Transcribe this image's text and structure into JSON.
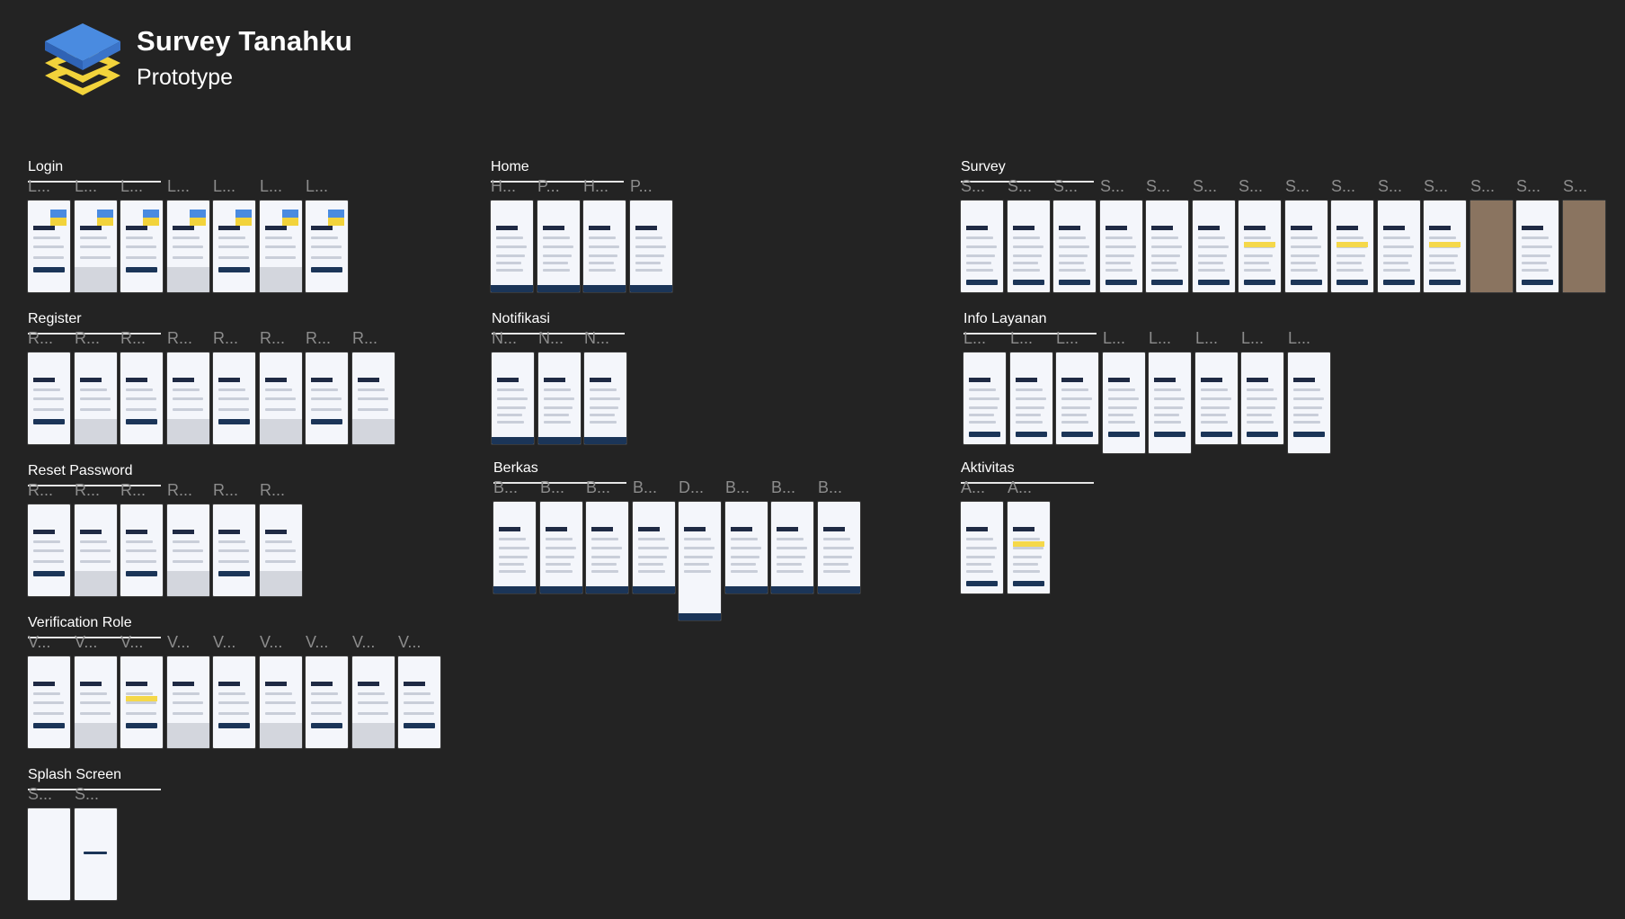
{
  "header": {
    "title": "Survey Tanahku",
    "subtitle": "Prototype",
    "logo_colors": {
      "blue": "#3a7bd5",
      "yellow": "#f2d33b"
    }
  },
  "sections": {
    "login": {
      "title": "Login",
      "frames": [
        "L...",
        "L...",
        "L...",
        "L...",
        "L...",
        "L...",
        "L..."
      ]
    },
    "register": {
      "title": "Register",
      "frames": [
        "R...",
        "R...",
        "R...",
        "R...",
        "R...",
        "R...",
        "R...",
        "R..."
      ]
    },
    "reset_password": {
      "title": "Reset Password",
      "frames": [
        "R...",
        "R...",
        "R...",
        "R...",
        "R...",
        "R..."
      ]
    },
    "verification_role": {
      "title": "Verification Role",
      "frames": [
        "V...",
        "V...",
        "V...",
        "V...",
        "V...",
        "V...",
        "V...",
        "V...",
        "V..."
      ]
    },
    "splash_screen": {
      "title": "Splash Screen",
      "frames": [
        "S...",
        "S..."
      ]
    },
    "home": {
      "title": "Home",
      "frames": [
        "H...",
        "P...",
        "H...",
        "P..."
      ]
    },
    "notifikasi": {
      "title": "Notifikasi",
      "frames": [
        "N...",
        "N...",
        "N..."
      ]
    },
    "berkas": {
      "title": "Berkas",
      "frames": [
        "B...",
        "B...",
        "B...",
        "B...",
        "D...",
        "B...",
        "B...",
        "B..."
      ]
    },
    "survey": {
      "title": "Survey",
      "frames": [
        "S...",
        "S...",
        "S...",
        "S...",
        "S...",
        "S...",
        "S...",
        "S...",
        "S...",
        "S...",
        "S...",
        "S...",
        "S...",
        "S..."
      ]
    },
    "info_layanan": {
      "title": "Info Layanan",
      "frames": [
        "L...",
        "L...",
        "L...",
        "L...",
        "L...",
        "L...",
        "L...",
        "L..."
      ]
    },
    "aktivitas": {
      "title": "Aktivitas",
      "frames": [
        "A...",
        "A..."
      ]
    }
  },
  "colors": {
    "background": "#232323",
    "frame_bg": "#f4f6fb",
    "primary_navy": "#1b3558",
    "accent_yellow": "#f5d84a"
  }
}
